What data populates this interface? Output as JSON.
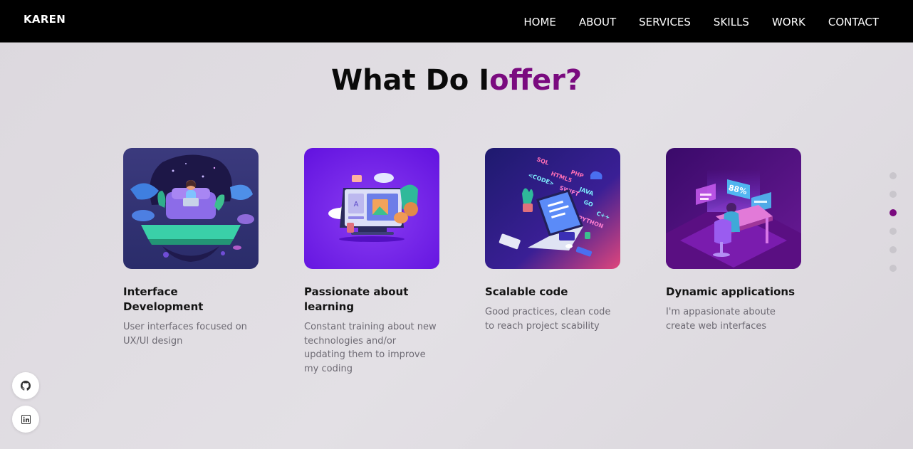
{
  "nav": {
    "brand": "KAREN",
    "links": [
      "HOME",
      "ABOUT",
      "SERVICES",
      "SKILLS",
      "WORK",
      "CONTACT"
    ]
  },
  "section": {
    "title_main": "What Do I",
    "title_accent": "offer?",
    "accent_color": "#7a0a7f"
  },
  "cards": [
    {
      "title": "Interface Development",
      "description": "User interfaces focused on UX/UI design",
      "icon": "woman-on-floating-island-illustration"
    },
    {
      "title": "Passionate about learning",
      "description": "Constant training about new technologies and/or updating them to improve my coding",
      "icon": "computer-screen-illustration"
    },
    {
      "title": "Scalable code",
      "description": "Good practices, clean code to reach project scability",
      "icon": "laptop-code-languages-illustration"
    },
    {
      "title": "Dynamic applications",
      "description": "I'm appasionate aboute create web interfaces",
      "icon": "person-at-desk-holograms-illustration",
      "hologram_text": "88%"
    }
  ],
  "section_dots": {
    "count": 6,
    "active_index": 2
  },
  "social": [
    "github-icon",
    "linkedin-icon"
  ]
}
